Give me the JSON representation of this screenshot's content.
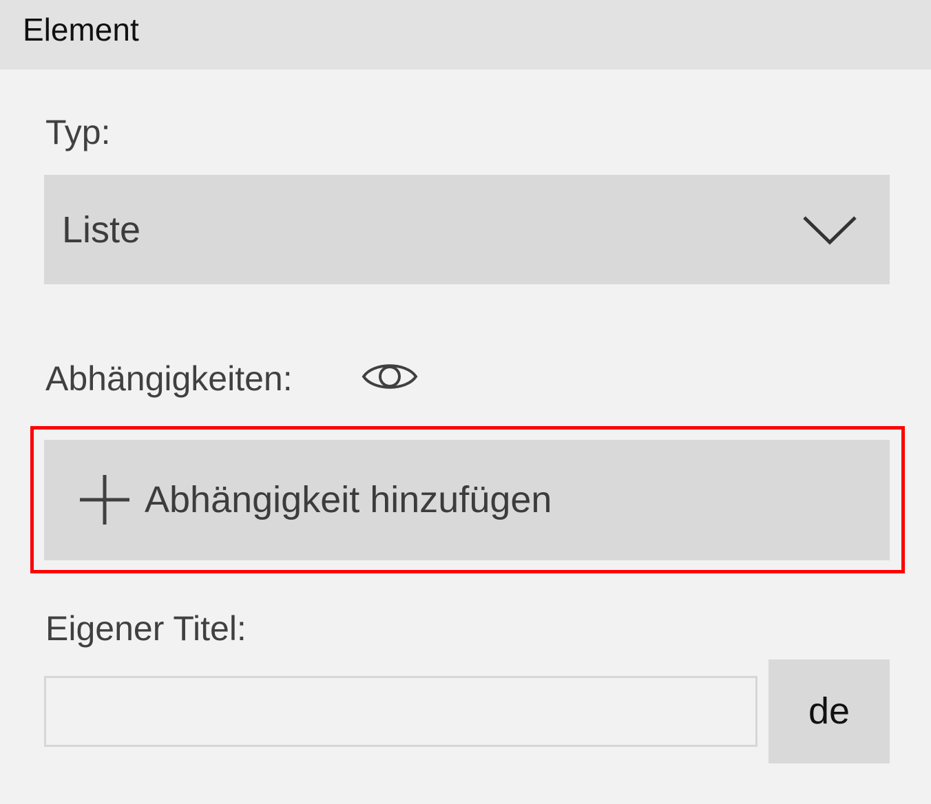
{
  "panel": {
    "title": "Element"
  },
  "type_field": {
    "label": "Typ:",
    "selected": "Liste",
    "icon": "chevron-down-icon"
  },
  "dependencies": {
    "label": "Abhängigkeiten:",
    "visibility_icon": "eye-icon",
    "add_button_label": "Abhängigkeit hinzufügen",
    "add_icon": "plus-icon",
    "highlight_color": "#ff0000"
  },
  "custom_title": {
    "label": "Eigener Titel:",
    "value": "",
    "language_button": "de"
  },
  "colors": {
    "panel_bg": "#f2f2f2",
    "header_bg": "#e2e2e2",
    "control_bg": "#d9d9d9",
    "text": "#404040"
  }
}
